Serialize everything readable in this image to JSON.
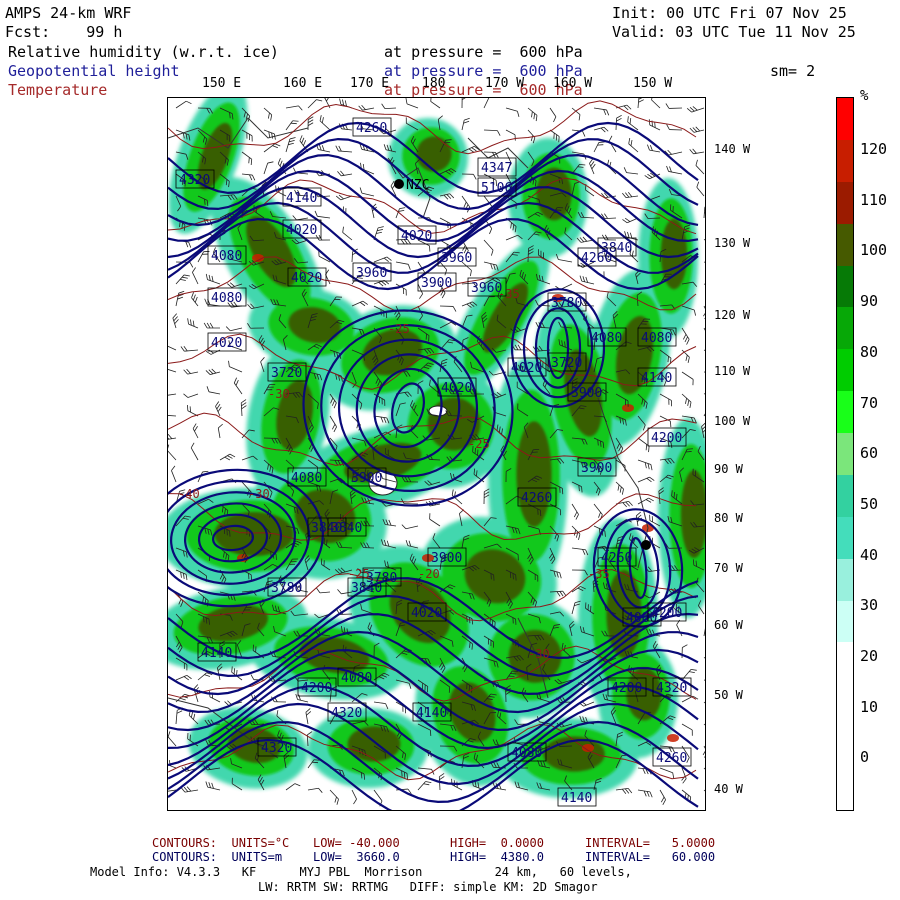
{
  "header": {
    "line1_left": "AMPS 24-km WRF",
    "line2_left": "Fcst:    99 h",
    "line1_right": "Init: 00 UTC Fri 07 Nov 25",
    "line2_right": "Valid: 03 UTC Tue 11 Nov 25",
    "fields": [
      {
        "name": "Relative humidity (w.r.t. ice)",
        "level": "at pressure =  600 hPa"
      },
      {
        "name": "Geopotential height",
        "level": "at pressure =  600 hPa"
      },
      {
        "name": "Temperature",
        "level": "at pressure =  600 hPa"
      }
    ],
    "smoothing": "sm= 2"
  },
  "map": {
    "top_labels": [
      "150 E",
      "160 E",
      "170 E",
      "180",
      "170 W",
      "160 W",
      "150 W"
    ],
    "right_labels": [
      "140 W",
      "130 W",
      "120 W",
      "110 W",
      "100 W",
      "90 W",
      "80 W",
      "70 W",
      "60 W",
      "50 W",
      "40 W"
    ],
    "station_label": "NZC",
    "height_labels": [
      "4260",
      "4320",
      "4140",
      "4020",
      "4080",
      "4080",
      "4020",
      "3960",
      "4020",
      "3720",
      "3780",
      "3840",
      "3900",
      "4020",
      "4080",
      "3840",
      "3840",
      "3720",
      "3780",
      "3840",
      "4080",
      "4200",
      "4320",
      "4140",
      "4080",
      "4260",
      "4140",
      "4080",
      "4200",
      "4260",
      "3960",
      "4020",
      "3900",
      "4260",
      "4320",
      "4200",
      "4080",
      "4020",
      "4140",
      "3780",
      "3900",
      "4020",
      "3960",
      "3900",
      "3900",
      "4260",
      "4080",
      "4200",
      "4140",
      "4320",
      "4347",
      "5106"
    ],
    "temp_labels": [
      "-25",
      "-30",
      "-35",
      "-25",
      "-20",
      "-30",
      "-25",
      "-35",
      "-40",
      "-30"
    ],
    "colors": {
      "height": "#0a0a78",
      "temp": "#8b1a1a",
      "barb": "#222222",
      "coast": "#333333"
    }
  },
  "colorbar": {
    "unit": "%",
    "ticks": [
      "120",
      "110",
      "100",
      "90",
      "80",
      "70",
      "60",
      "50",
      "40",
      "30",
      "20",
      "10",
      "0"
    ],
    "colors": [
      "#ff0000",
      "#c81e00",
      "#9b1b00",
      "#465a00",
      "#067a06",
      "#07a807",
      "#00cc00",
      "#19ff19",
      "#7be67b",
      "#33d1a0",
      "#44ddbb",
      "#99f0dd",
      "#ccfff5",
      "#ffffff",
      "#ffffff",
      "#ffffff",
      "#ffffff"
    ]
  },
  "footer": {
    "temp_contours": {
      "label": "CONTOURS:  UNITS=°C",
      "low": "LOW= -40.000",
      "high": "HIGH=  0.0000",
      "interval": "INTERVAL=   5.0000"
    },
    "height_contours": {
      "label": "CONTOURS:  UNITS=m",
      "low": "LOW=  3660.0",
      "high": "HIGH=  4380.0",
      "interval": "INTERVAL=   60.000"
    },
    "model_line": "Model Info: V4.3.3   KF      MYJ PBL  Morrison          24 km,   60 levels,",
    "physics_line": "LW: RRTM SW: RRTMG   DIFF: simple KM: 2D Smagor"
  }
}
